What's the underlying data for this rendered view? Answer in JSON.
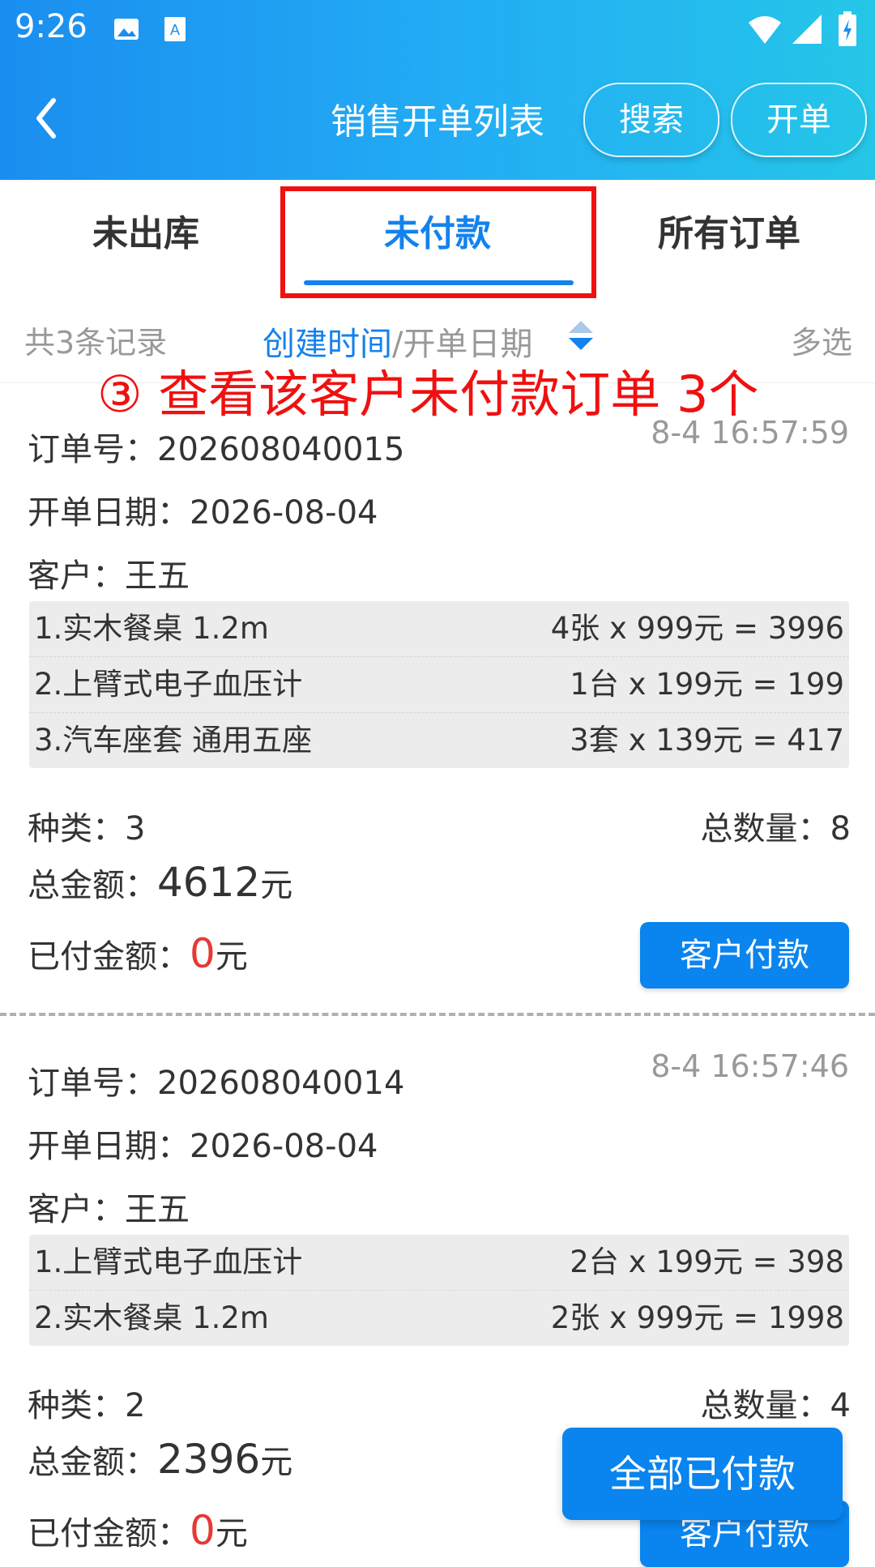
{
  "status_bar": {
    "time": "9:26",
    "icons": [
      "image-icon",
      "text-recognition-icon",
      "wifi-icon",
      "signal-icon",
      "battery-icon"
    ]
  },
  "topbar": {
    "title": "销售开单列表",
    "search_label": "搜索",
    "create_label": "开单",
    "back_icon": "back-arrow-icon"
  },
  "tabs": {
    "items": [
      "未出库",
      "未付款",
      "所有订单"
    ],
    "active": "未付款"
  },
  "sort_bar": {
    "count": "共3条记录",
    "sort_active": "创建时间",
    "sort_sep": "/",
    "sort_other": "开单日期",
    "multi": "多选"
  },
  "annotation": "③ 查看该客户未付款订单 3个",
  "orders": [
    {
      "order_no_label": "订单号：",
      "order_no": "202608040015",
      "timestamp": "8-4 16:57:59",
      "date_label": "开单日期：",
      "date": "2026-08-04",
      "customer_label": "客户：",
      "customer": "王五",
      "items": [
        {
          "name": "1.实木餐桌 1.2m",
          "calc": "4张 x 999元 = 3996"
        },
        {
          "name": "2.上臂式电子血压计",
          "calc": "1台 x 199元 = 199"
        },
        {
          "name": "3.汽车座套 通用五座",
          "calc": "3套 x 139元 = 417"
        }
      ],
      "kinds_label": "种类：",
      "kinds": "3",
      "qty_label": "总数量：",
      "qty": "8",
      "total_label": "总金额：",
      "total": "4612",
      "unit": "元",
      "paid_label": "已付金额：",
      "paid": "0",
      "pay_button": "客户付款"
    },
    {
      "order_no_label": "订单号：",
      "order_no": "202608040014",
      "timestamp": "8-4 16:57:46",
      "date_label": "开单日期：",
      "date": "2026-08-04",
      "customer_label": "客户：",
      "customer": "王五",
      "items": [
        {
          "name": "1.上臂式电子血压计",
          "calc": "2台 x 199元 = 398"
        },
        {
          "name": "2.实木餐桌 1.2m",
          "calc": "2张 x 999元 = 1998"
        }
      ],
      "kinds_label": "种类：",
      "kinds": "2",
      "qty_label": "总数量：",
      "qty": "4",
      "total_label": "总金额：",
      "total": "2396",
      "unit": "元",
      "paid_label": "已付金额：",
      "paid": "0",
      "pay_button": "客户付款"
    }
  ],
  "fab_label": "全部已付款",
  "colors": {
    "primary": "#1382ee",
    "header_start": "#1a8ef0",
    "header_end": "#25c6e8",
    "annotation": "#f01010",
    "amount_red": "#e53935"
  }
}
